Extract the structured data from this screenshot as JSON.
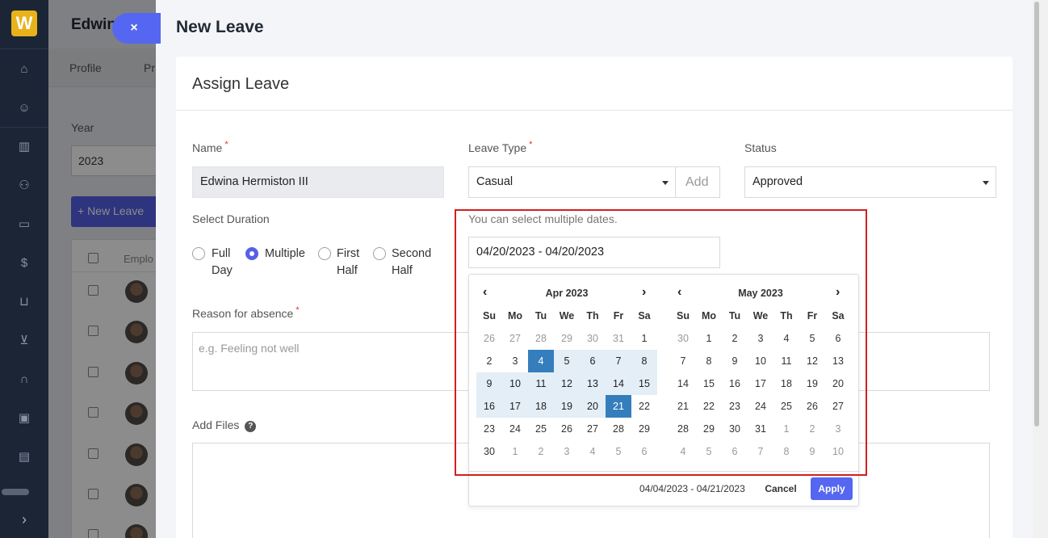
{
  "app": {
    "logo_letter": "W"
  },
  "sidebar": {
    "icons": [
      "home-icon",
      "user-icon",
      "building-icon",
      "users-icon",
      "briefcase-icon",
      "dollar-icon",
      "basket-icon",
      "cart-icon",
      "headset-icon",
      "calendar-icon",
      "message-icon"
    ],
    "expand_icon": "›"
  },
  "background_page": {
    "title": "Edwin",
    "tabs": [
      "Profile",
      "Pr"
    ],
    "year_label": "Year",
    "year_value": "2023",
    "new_leave_button": "+ New Leave",
    "table_header": "Emplo"
  },
  "close_button": {
    "label": "×"
  },
  "modal": {
    "title": "New Leave",
    "card_title": "Assign Leave",
    "name": {
      "label": "Name",
      "required_mark": "*",
      "value": "Edwina Hermiston III"
    },
    "leave_type": {
      "label": "Leave Type",
      "required_mark": "*",
      "value": "Casual",
      "add_label": "Add"
    },
    "status": {
      "label": "Status",
      "value": "Approved"
    },
    "duration": {
      "label": "Select Duration",
      "options": [
        {
          "line1": "Full",
          "line2": "Day",
          "selected": false
        },
        {
          "line1": "Multiple",
          "line2": "",
          "selected": true
        },
        {
          "line1": "First",
          "line2": "Half",
          "selected": false
        },
        {
          "line1": "Second",
          "line2": "Half",
          "selected": false
        }
      ]
    },
    "date_hint": "You can select multiple dates.",
    "date_value": "04/20/2023 - 04/20/2023",
    "reason": {
      "label": "Reason for absence",
      "required_mark": "*",
      "placeholder": "e.g. Feeling not well"
    },
    "files": {
      "label": "Add Files",
      "help_icon": "?"
    }
  },
  "datepicker": {
    "prev_icon": "‹",
    "next_icon": "›",
    "weekdays": [
      "Su",
      "Mo",
      "Tu",
      "We",
      "Th",
      "Fr",
      "Sa"
    ],
    "left_month": {
      "title": "Apr 2023",
      "days": [
        "26",
        "27",
        "28",
        "29",
        "30",
        "31",
        "1",
        "2",
        "3",
        "4",
        "5",
        "6",
        "7",
        "8",
        "9",
        "10",
        "11",
        "12",
        "13",
        "14",
        "15",
        "16",
        "17",
        "18",
        "19",
        "20",
        "21",
        "22",
        "23",
        "24",
        "25",
        "26",
        "27",
        "28",
        "29",
        "30",
        "1",
        "2",
        "3",
        "4",
        "5",
        "6"
      ],
      "off_indices": [
        0,
        1,
        2,
        3,
        4,
        5,
        36,
        37,
        38,
        39,
        40,
        41
      ],
      "range_start_index": 9,
      "range_end_index": 26
    },
    "right_month": {
      "title": "May 2023",
      "days": [
        "30",
        "1",
        "2",
        "3",
        "4",
        "5",
        "6",
        "7",
        "8",
        "9",
        "10",
        "11",
        "12",
        "13",
        "14",
        "15",
        "16",
        "17",
        "18",
        "19",
        "20",
        "21",
        "22",
        "23",
        "24",
        "25",
        "26",
        "27",
        "28",
        "29",
        "30",
        "31",
        "1",
        "2",
        "3",
        "4",
        "5",
        "6",
        "7",
        "8",
        "9",
        "10"
      ],
      "off_indices": [
        0,
        32,
        33,
        34,
        35,
        36,
        37,
        38,
        39,
        40,
        41
      ]
    },
    "selected_range": "04/04/2023 - 04/21/2023",
    "cancel_label": "Cancel",
    "apply_label": "Apply"
  }
}
